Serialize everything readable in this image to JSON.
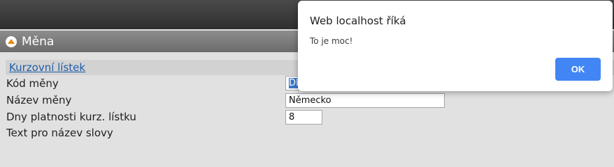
{
  "panel": {
    "title": "Měna",
    "section_link": "Kurzovní lístek"
  },
  "form": {
    "currency_code": {
      "label": "Kód měny",
      "value": "DE"
    },
    "currency_name": {
      "label": "Název měny",
      "value": "Německo"
    },
    "validity_days": {
      "label": "Dny platnosti kurz. lístku",
      "value": "8"
    },
    "word_text": {
      "label": "Text pro název slovy"
    }
  },
  "dialog": {
    "title": "Web localhost říká",
    "message": "To je moc!",
    "ok_label": "OK"
  },
  "icons": {
    "collapse": "chevron-up-icon"
  },
  "colors": {
    "accent": "#4285f4",
    "link": "#1f5da8"
  }
}
